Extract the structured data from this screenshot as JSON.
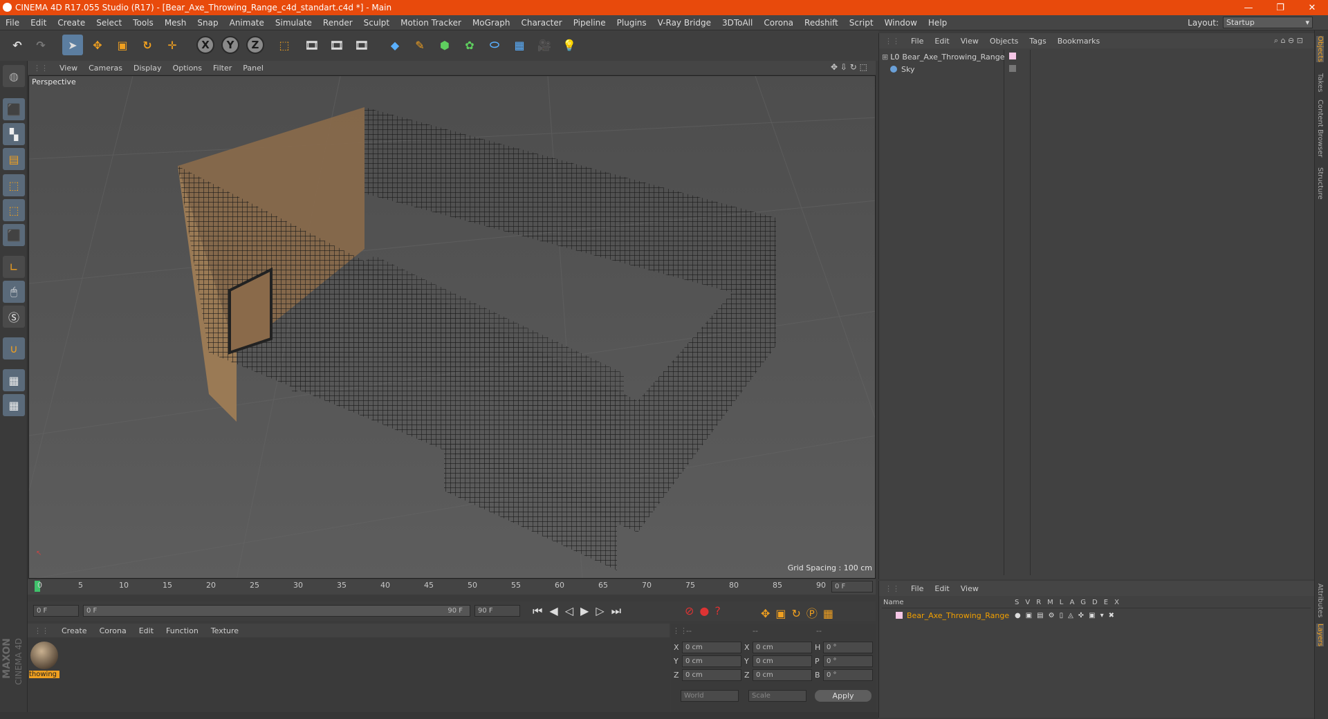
{
  "window": {
    "title": "CINEMA 4D R17.055 Studio (R17) - [Bear_Axe_Throwing_Range_c4d_standart.c4d *] - Main",
    "minimize": "—",
    "restore": "❐",
    "close": "✕"
  },
  "menu": [
    "File",
    "Edit",
    "Create",
    "Select",
    "Tools",
    "Mesh",
    "Snap",
    "Animate",
    "Simulate",
    "Render",
    "Sculpt",
    "Motion Tracker",
    "MoGraph",
    "Character",
    "Pipeline",
    "Plugins",
    "V-Ray Bridge",
    "3DToAll",
    "Corona",
    "Redshift",
    "Script",
    "Window",
    "Help"
  ],
  "layout": {
    "label": "Layout:",
    "value": "Startup"
  },
  "toolbar": {
    "x": "X",
    "y": "Y",
    "z": "Z"
  },
  "viewport": {
    "menu": [
      "View",
      "Cameras",
      "Display",
      "Options",
      "Filter",
      "Panel"
    ],
    "label": "Perspective",
    "grid_spacing": "Grid Spacing : 100 cm"
  },
  "timeline": {
    "ticks": [
      "0",
      "5",
      "10",
      "15",
      "20",
      "25",
      "30",
      "35",
      "40",
      "45",
      "50",
      "55",
      "60",
      "65",
      "70",
      "75",
      "80",
      "85",
      "90"
    ],
    "current": "0 F",
    "start": "0 F",
    "range_start": "0 F",
    "range_end": "90 F",
    "end": "90 F"
  },
  "materials": {
    "menu": [
      "Create",
      "Corona",
      "Edit",
      "Function",
      "Texture"
    ],
    "items": [
      {
        "name": "thowing"
      }
    ]
  },
  "coords": {
    "headers": [
      "--",
      "--",
      "--"
    ],
    "rows": [
      {
        "a": "X",
        "av": "0 cm",
        "b": "X",
        "bv": "0 cm",
        "c": "H",
        "cv": "0 °"
      },
      {
        "a": "Y",
        "av": "0 cm",
        "b": "Y",
        "bv": "0 cm",
        "c": "P",
        "cv": "0 °"
      },
      {
        "a": "Z",
        "av": "0 cm",
        "b": "Z",
        "bv": "0 cm",
        "c": "B",
        "cv": "0 °"
      }
    ],
    "world": "World",
    "scale": "Scale",
    "apply": "Apply"
  },
  "objects": {
    "menu": [
      "File",
      "Edit",
      "View",
      "Objects",
      "Tags",
      "Bookmarks"
    ],
    "items": [
      {
        "name": "Bear_Axe_Throwing_Range"
      },
      {
        "name": "Sky"
      }
    ]
  },
  "layers": {
    "menu": [
      "File",
      "Edit",
      "View"
    ],
    "name_header": "Name",
    "cols": [
      "S",
      "V",
      "R",
      "M",
      "L",
      "A",
      "G",
      "D",
      "E",
      "X"
    ],
    "items": [
      {
        "name": "Bear_Axe_Throwing_Range",
        "color": "#f2a000"
      }
    ]
  },
  "right_tabs": [
    "Objects",
    "Takes",
    "Content Browser",
    "Structure",
    "Attributes",
    "Layers"
  ],
  "brand": {
    "line1": "MAXON",
    "line2": "CINEMA 4D"
  },
  "colors": {
    "title_bar": "#e84a0c",
    "accent": "#f0a020",
    "selected": "#5c7ea0"
  }
}
